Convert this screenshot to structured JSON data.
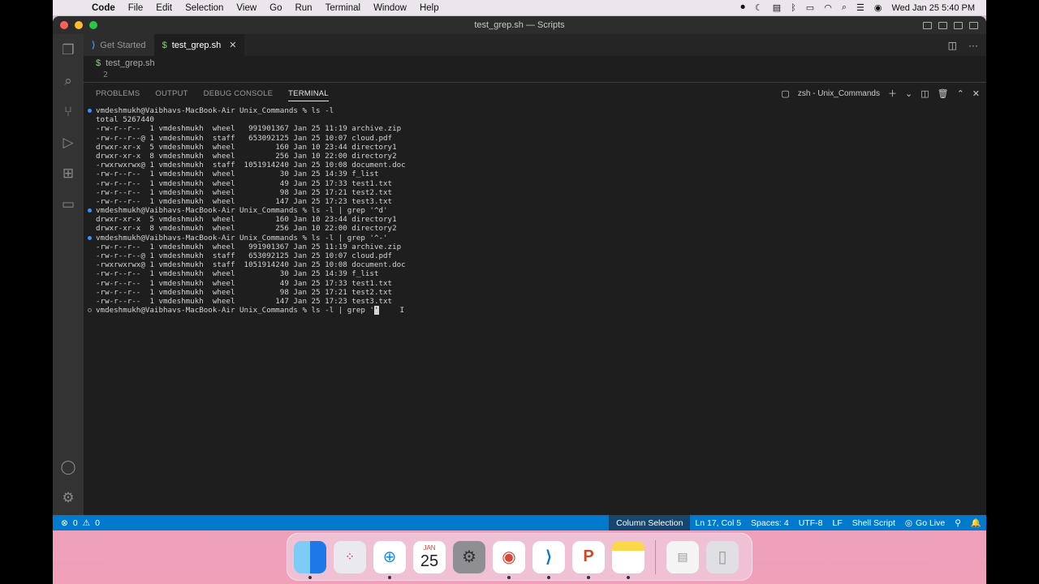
{
  "menubar": {
    "app": "Code",
    "items": [
      "File",
      "Edit",
      "Selection",
      "View",
      "Go",
      "Run",
      "Terminal",
      "Window",
      "Help"
    ],
    "clock": "Wed Jan 25  5:40 PM"
  },
  "window": {
    "title": "test_grep.sh — Scripts"
  },
  "tabs": [
    {
      "label": "Get Started",
      "icon": "vscode-icon"
    },
    {
      "label": "test_grep.sh",
      "icon": "shell-icon",
      "active": true
    }
  ],
  "breadcrumb": {
    "file": "test_grep.sh"
  },
  "editor": {
    "line_number": "2"
  },
  "panel": {
    "tabs": [
      "PROBLEMS",
      "OUTPUT",
      "DEBUG CONSOLE",
      "TERMINAL"
    ],
    "active_tab": "TERMINAL",
    "terminal_name": "zsh - Unix_Commands"
  },
  "terminal": {
    "lines": [
      {
        "mark": "blue",
        "text": "vmdeshmukh@Vaibhavs-MacBook-Air Unix_Commands % ls -l"
      },
      {
        "mark": "",
        "text": "total 5267440"
      },
      {
        "mark": "",
        "text": "-rw-r--r--  1 vmdeshmukh  wheel   991901367 Jan 25 11:19 archive.zip"
      },
      {
        "mark": "",
        "text": "-rw-r--r--@ 1 vmdeshmukh  staff   653092125 Jan 25 10:07 cloud.pdf"
      },
      {
        "mark": "",
        "text": "drwxr-xr-x  5 vmdeshmukh  wheel         160 Jan 10 23:44 directory1"
      },
      {
        "mark": "",
        "text": "drwxr-xr-x  8 vmdeshmukh  wheel         256 Jan 10 22:00 directory2"
      },
      {
        "mark": "",
        "text": "-rwxrwxrwx@ 1 vmdeshmukh  staff  1051914240 Jan 25 10:08 document.doc"
      },
      {
        "mark": "",
        "text": "-rw-r--r--  1 vmdeshmukh  wheel          30 Jan 25 14:39 f_list"
      },
      {
        "mark": "",
        "text": "-rw-r--r--  1 vmdeshmukh  wheel          49 Jan 25 17:33 test1.txt"
      },
      {
        "mark": "",
        "text": "-rw-r--r--  1 vmdeshmukh  wheel          98 Jan 25 17:21 test2.txt"
      },
      {
        "mark": "",
        "text": "-rw-r--r--  1 vmdeshmukh  wheel         147 Jan 25 17:23 test3.txt"
      },
      {
        "mark": "blue",
        "text": "vmdeshmukh@Vaibhavs-MacBook-Air Unix_Commands % ls -l | grep '^d'"
      },
      {
        "mark": "",
        "text": "drwxr-xr-x  5 vmdeshmukh  wheel         160 Jan 10 23:44 directory1"
      },
      {
        "mark": "",
        "text": "drwxr-xr-x  8 vmdeshmukh  wheel         256 Jan 10 22:00 directory2"
      },
      {
        "mark": "blue",
        "text": "vmdeshmukh@Vaibhavs-MacBook-Air Unix_Commands % ls -l | grep '^-'"
      },
      {
        "mark": "",
        "text": "-rw-r--r--  1 vmdeshmukh  wheel   991901367 Jan 25 11:19 archive.zip"
      },
      {
        "mark": "",
        "text": "-rw-r--r--@ 1 vmdeshmukh  staff   653092125 Jan 25 10:07 cloud.pdf"
      },
      {
        "mark": "",
        "text": "-rwxrwxrwx@ 1 vmdeshmukh  staff  1051914240 Jan 25 10:08 document.doc"
      },
      {
        "mark": "",
        "text": "-rw-r--r--  1 vmdeshmukh  wheel          30 Jan 25 14:39 f_list"
      },
      {
        "mark": "",
        "text": "-rw-r--r--  1 vmdeshmukh  wheel          49 Jan 25 17:33 test1.txt"
      },
      {
        "mark": "",
        "text": "-rw-r--r--  1 vmdeshmukh  wheel          98 Jan 25 17:21 test2.txt"
      },
      {
        "mark": "",
        "text": "-rw-r--r--  1 vmdeshmukh  wheel         147 Jan 25 17:23 test3.txt"
      }
    ],
    "prompt": "vmdeshmukh@Vaibhavs-MacBook-Air Unix_Commands % ls -l | grep '",
    "cursor_char": "'"
  },
  "statusbar": {
    "errors": "0",
    "warnings": "0",
    "column_selection": "Column Selection",
    "position": "Ln 17, Col 5",
    "spaces": "Spaces: 4",
    "encoding": "UTF-8",
    "eol": "LF",
    "language": "Shell Script",
    "go_live": "Go Live"
  },
  "dock": {
    "calendar_month": "JAN",
    "calendar_day": "25"
  }
}
